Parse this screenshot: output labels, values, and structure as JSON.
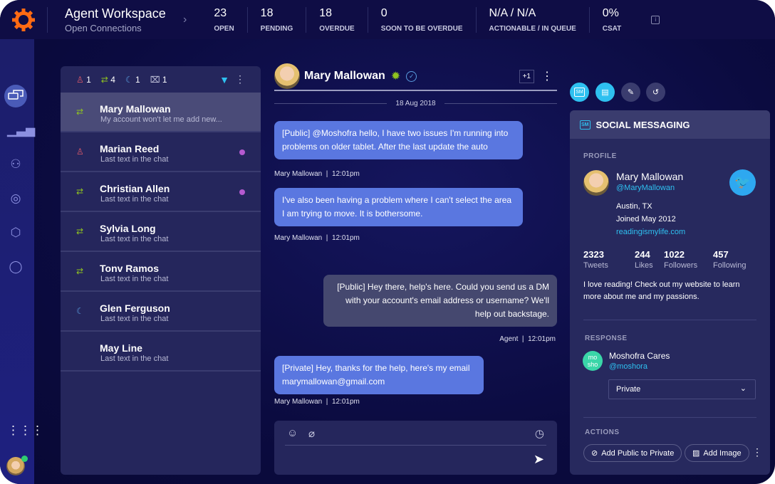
{
  "header": {
    "title": "Agent Workspace",
    "subtitle": "Open Connections",
    "stats": [
      {
        "value": "23",
        "label": "OPEN"
      },
      {
        "value": "18",
        "label": "PENDING"
      },
      {
        "value": "18",
        "label": "OVERDUE"
      },
      {
        "value": "0",
        "label": "SOON TO BE OVERDUE"
      },
      {
        "value": "N/A / N/A",
        "label": "ACTIONABLE / IN QUEUE"
      },
      {
        "value": "0%",
        "label": "CSAT"
      }
    ]
  },
  "filters": {
    "alert": "1",
    "transfer": "4",
    "snooze": "1",
    "closed": "1"
  },
  "conversations": [
    {
      "name": "Mary Mallowan",
      "snippet": "My account won't let me add new...",
      "icon": "transfer",
      "unread": false
    },
    {
      "name": "Marian Reed",
      "snippet": "Last text in the chat",
      "icon": "alert",
      "unread": true
    },
    {
      "name": "Christian Allen",
      "snippet": "Last text in the chat",
      "icon": "transfer",
      "unread": true
    },
    {
      "name": "Sylvia Long",
      "snippet": "Last text in the chat",
      "icon": "transfer",
      "unread": false
    },
    {
      "name": "Tonv Ramos",
      "snippet": "Last text in the chat",
      "icon": "transfer",
      "unread": false
    },
    {
      "name": "Glen Ferguson",
      "snippet": "Last text in the chat",
      "icon": "snooze",
      "unread": false
    },
    {
      "name": "May Line",
      "snippet": "Last text in the chat",
      "icon": "",
      "unread": false
    }
  ],
  "chat": {
    "contact": "Mary Mallowan",
    "badge_count": "+1",
    "date": "18 Aug 2018",
    "messages": [
      {
        "text": "[Public] @Moshofra hello, I have two issues I'm running into problems on older tablet. After the last update the auto",
        "meta": "Mary Mallowan  |  12:01pm",
        "from": "customer"
      },
      {
        "text": "I've also been having a problem where I can't select the area I am trying to move. It is bothersome.",
        "meta": "Mary Mallowan  |  12:01pm",
        "from": "customer"
      },
      {
        "text": "[Public] Hey there, help's here. Could you send us a DM with your account's email address or username? We'll help out backstage.",
        "meta": "Agent  |  12:01pm",
        "from": "agent"
      },
      {
        "text": "[Private] Hey, thanks for the help, here's my email marymallowan@gmail.com",
        "meta": "Mary Mallowan  |  12:01pm",
        "from": "customer"
      }
    ]
  },
  "panel": {
    "title": "SOCIAL MESSAGING",
    "sm": "SM",
    "profile_label": "PROFILE",
    "name": "Mary Mallowan",
    "handle": "@MaryMallowan",
    "location": "Austin, TX",
    "joined": "Joined May 2012",
    "website": "readingismylife.com",
    "counts": [
      {
        "v": "2323",
        "l": "Tweets"
      },
      {
        "v": "244",
        "l": "Likes"
      },
      {
        "v": "1022",
        "l": "Followers"
      },
      {
        "v": "457",
        "l": "Following"
      }
    ],
    "bio": "I love reading! Check out my website to learn more about me and my passions.",
    "response_label": "RESPONSE",
    "brand_avatar": "mo sho",
    "brand_name": "Moshofra Cares",
    "brand_handle": "@moshora",
    "visibility": "Private",
    "actions_label": "ACTIONS",
    "action1": "Add Public to Private",
    "action2": "Add Image"
  },
  "colors": {
    "accent": "#2ec0f0",
    "logo": "#ff6a13",
    "customer_bubble": "#5a77e0",
    "agent_bubble": "#45486f",
    "unread": "#b55ad0",
    "transfer": "#8fc31f",
    "alert": "#e05a6a"
  }
}
